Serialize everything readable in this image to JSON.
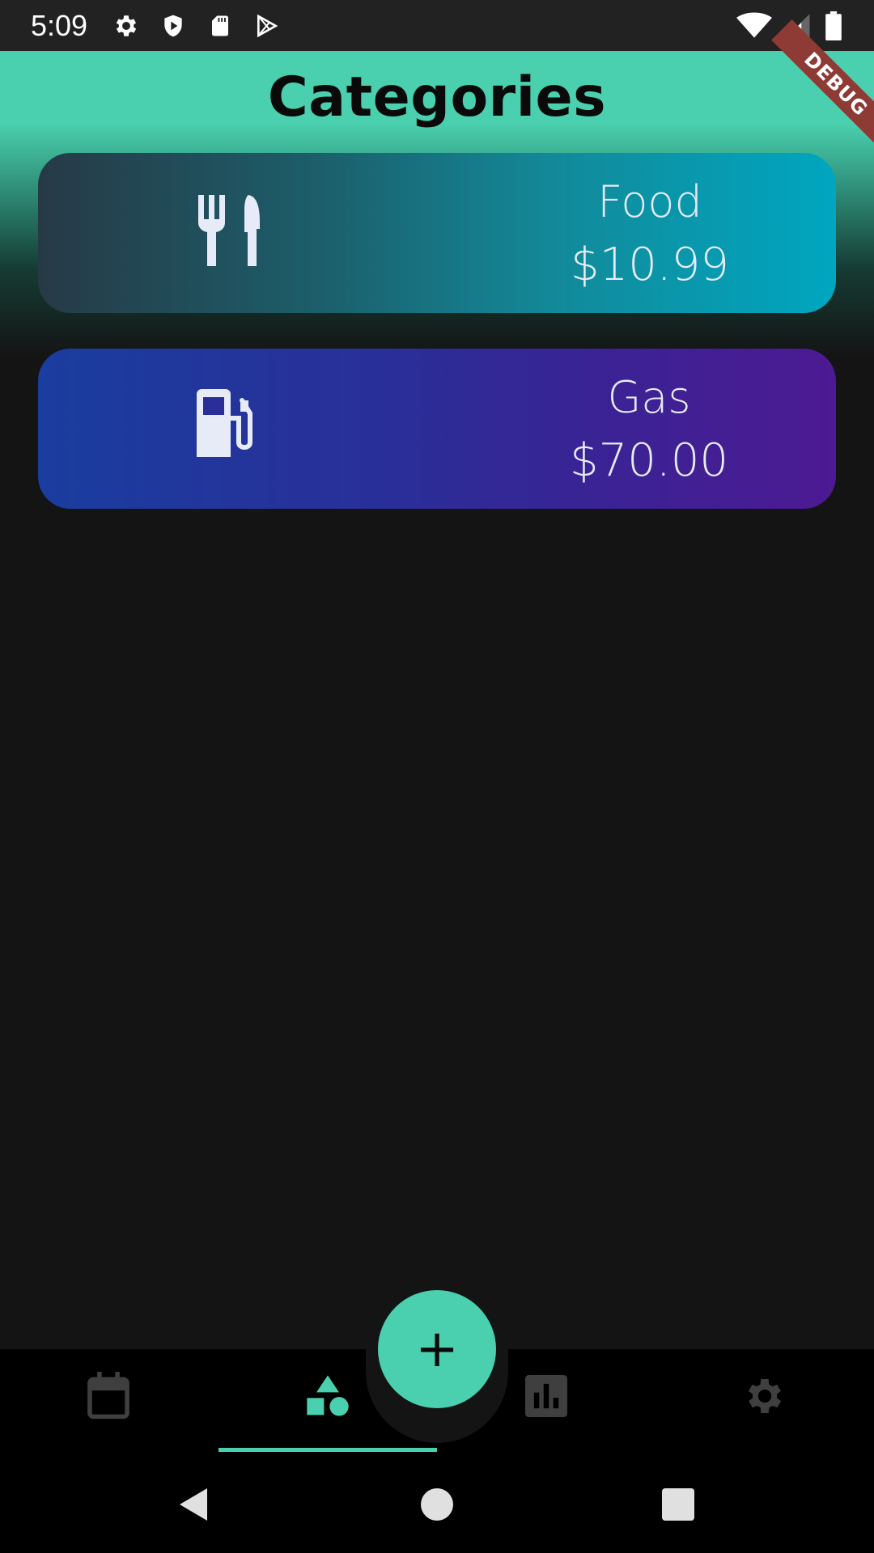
{
  "status_bar": {
    "time": "5:09",
    "left_icons": [
      "gear-icon",
      "shield-play-icon",
      "sd-card-icon",
      "play-store-icon"
    ],
    "right_icons": [
      "wifi-icon",
      "signal-icon",
      "battery-icon"
    ]
  },
  "header": {
    "title": "Categories",
    "debug_label": "DEBUG",
    "accent_color": "#4ad0ae"
  },
  "categories": [
    {
      "name": "Food",
      "amount": "$10.99",
      "icon": "fork-knife-icon",
      "gradient": [
        "#263a46",
        "#00a6c0"
      ]
    },
    {
      "name": "Gas",
      "amount": "$70.00",
      "icon": "gas-pump-icon",
      "gradient": [
        "#1a3d9f",
        "#4c1a92"
      ]
    }
  ],
  "bottom_nav": {
    "items": [
      {
        "name": "calendar",
        "icon": "calendar-icon",
        "active": false
      },
      {
        "name": "categories",
        "icon": "shapes-icon",
        "active": true
      },
      {
        "name": "stats",
        "icon": "bar-chart-icon",
        "active": false
      },
      {
        "name": "settings",
        "icon": "gear-icon",
        "active": false
      }
    ],
    "fab_label": "+"
  },
  "system_nav": [
    "back-icon",
    "home-icon",
    "recents-icon"
  ]
}
